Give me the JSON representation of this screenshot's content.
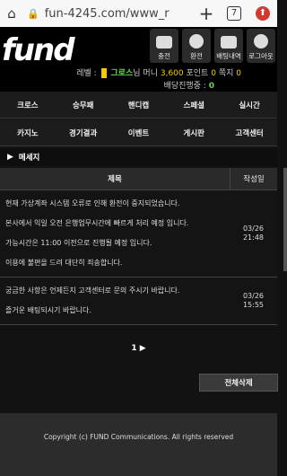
{
  "browser": {
    "url": "fun-4245.com/www_r",
    "tab_count": "7"
  },
  "header": {
    "logo": "fund",
    "icons": [
      {
        "label": "충전",
        "icon": "wallet-icon"
      },
      {
        "label": "환전",
        "icon": "won-coin-icon"
      },
      {
        "label": "배팅내역",
        "icon": "document-icon"
      },
      {
        "label": "로그아웃",
        "icon": "chat-bubble-icon"
      }
    ],
    "level_label": "레벨 :",
    "user_name": "그로스",
    "user_suffix": "님",
    "money_label": "머니",
    "money_value": "3,600",
    "point_label": "포인트",
    "point_value": "0",
    "note_label": "쪽지",
    "note_value": "0",
    "betting_label": "배당진행중 :",
    "betting_value": "0"
  },
  "menu": {
    "row1": [
      "크로스",
      "승무패",
      "핸디캡",
      "스페셜",
      "실시간"
    ],
    "row2": [
      "카지노",
      "경기결과",
      "이벤트",
      "게시판",
      "고객센터"
    ]
  },
  "section_title": "메세지",
  "table": {
    "col_title": "제목",
    "col_date": "작성일",
    "rows": [
      {
        "lines": [
          "현재 가상계좌 시스템 오류로 인해 환전이 중지되었습니다.",
          "본사에서 익일 오전 은행업무시간에 빠르게 처리 예정 입니다.",
          "가능시간은 11:00 이전으로 진행될 예정 입니다.",
          "이용에 불편을 드려 대단히 죄송합니다."
        ],
        "date": "03/26",
        "time": "21:48"
      },
      {
        "lines": [
          "궁금한 사항은 언제든지 고객센터로 문의 주시기 바랍니다.",
          "즐거운 배팅되시기 바랍니다."
        ],
        "date": "03/26",
        "time": "15:55"
      }
    ]
  },
  "pager": "1 ▶",
  "delete_all": "전체삭제",
  "footer": "Copyright (c) FUND Communications. All rights reserved"
}
